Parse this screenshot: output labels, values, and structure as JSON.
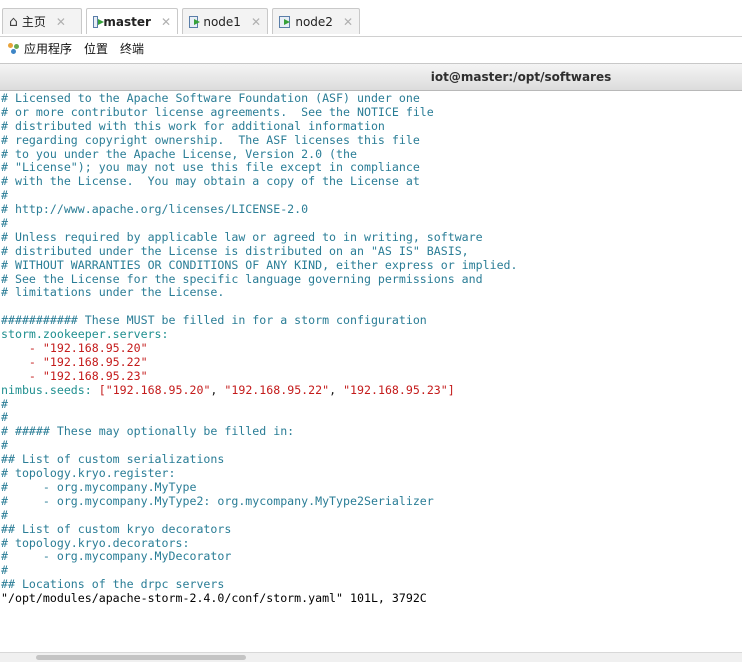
{
  "tabs": [
    {
      "label": "主页",
      "icon": "home-icon"
    },
    {
      "label": "master",
      "icon": "vm-icon"
    },
    {
      "label": "node1",
      "icon": "vm-icon"
    },
    {
      "label": "node2",
      "icon": "vm-icon"
    }
  ],
  "menubar": {
    "apps": "应用程序",
    "places": "位置",
    "terminal": "终端"
  },
  "window_title": "iot@master:/opt/softwares",
  "terminal_lines": [
    "# Licensed to the Apache Software Foundation (ASF) under one",
    "# or more contributor license agreements.  See the NOTICE file",
    "# distributed with this work for additional information",
    "# regarding copyright ownership.  The ASF licenses this file",
    "# to you under the Apache License, Version 2.0 (the",
    "# \"License\"); you may not use this file except in compliance",
    "# with the License.  You may obtain a copy of the License at",
    "#",
    "# http://www.apache.org/licenses/LICENSE-2.0",
    "#",
    "# Unless required by applicable law or agreed to in writing, software",
    "# distributed under the License is distributed on an \"AS IS\" BASIS,",
    "# WITHOUT WARRANTIES OR CONDITIONS OF ANY KIND, either express or implied.",
    "# See the License for the specific language governing permissions and",
    "# limitations under the License.",
    "",
    "########### These MUST be filled in for a storm configuration",
    "storm.zookeeper.servers:",
    "    - \"192.168.95.20\"",
    "    - \"192.168.95.22\"",
    "    - \"192.168.95.23\"",
    "nimbus.seeds: [\"192.168.95.20\", \"192.168.95.22\", \"192.168.95.23\"]",
    "#",
    "#",
    "# ##### These may optionally be filled in:",
    "#",
    "## List of custom serializations",
    "# topology.kryo.register:",
    "#     - org.mycompany.MyType",
    "#     - org.mycompany.MyType2: org.mycompany.MyType2Serializer",
    "#",
    "## List of custom kryo decorators",
    "# topology.kryo.decorators:",
    "#     - org.mycompany.MyDecorator",
    "#",
    "## Locations of the drpc servers"
  ],
  "status_line": "\"/opt/modules/apache-storm-2.4.0/conf/storm.yaml\" 101L, 3792C",
  "colors": {
    "comment": "#2a7d96",
    "key": "#1f8f8f",
    "string": "#c41b1b"
  }
}
